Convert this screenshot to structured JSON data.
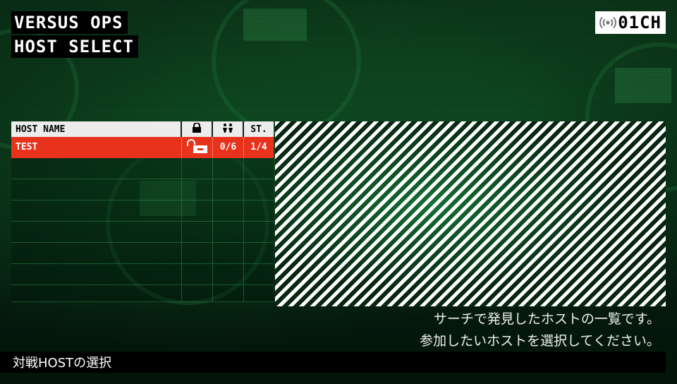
{
  "header": {
    "title_line1": "VERSUS OPS",
    "title_line2": "HOST SELECT"
  },
  "channel": {
    "icon": "signal-icon",
    "label": "01CH"
  },
  "host_table": {
    "columns": [
      {
        "label": "HOST NAME"
      },
      {
        "label": "",
        "icon": "lock-icon"
      },
      {
        "label": "",
        "icon": "players-icon"
      },
      {
        "label": "ST."
      }
    ],
    "rows": [
      {
        "host_name": "TEST",
        "lock": "unlocked-icon",
        "players": "0/6",
        "stage": "1/4"
      }
    ],
    "empty_rows": 7,
    "selected_row_color": "#e8321c"
  },
  "description": {
    "line1": "サーチで発見したホストの一覧です。",
    "line2": "参加したいホストを選択してください。"
  },
  "footer": {
    "help_text": "対戦HOSTの選択"
  },
  "colors": {
    "accent": "#e8321c",
    "background": "#06180c",
    "header_bg": "#ececec"
  }
}
